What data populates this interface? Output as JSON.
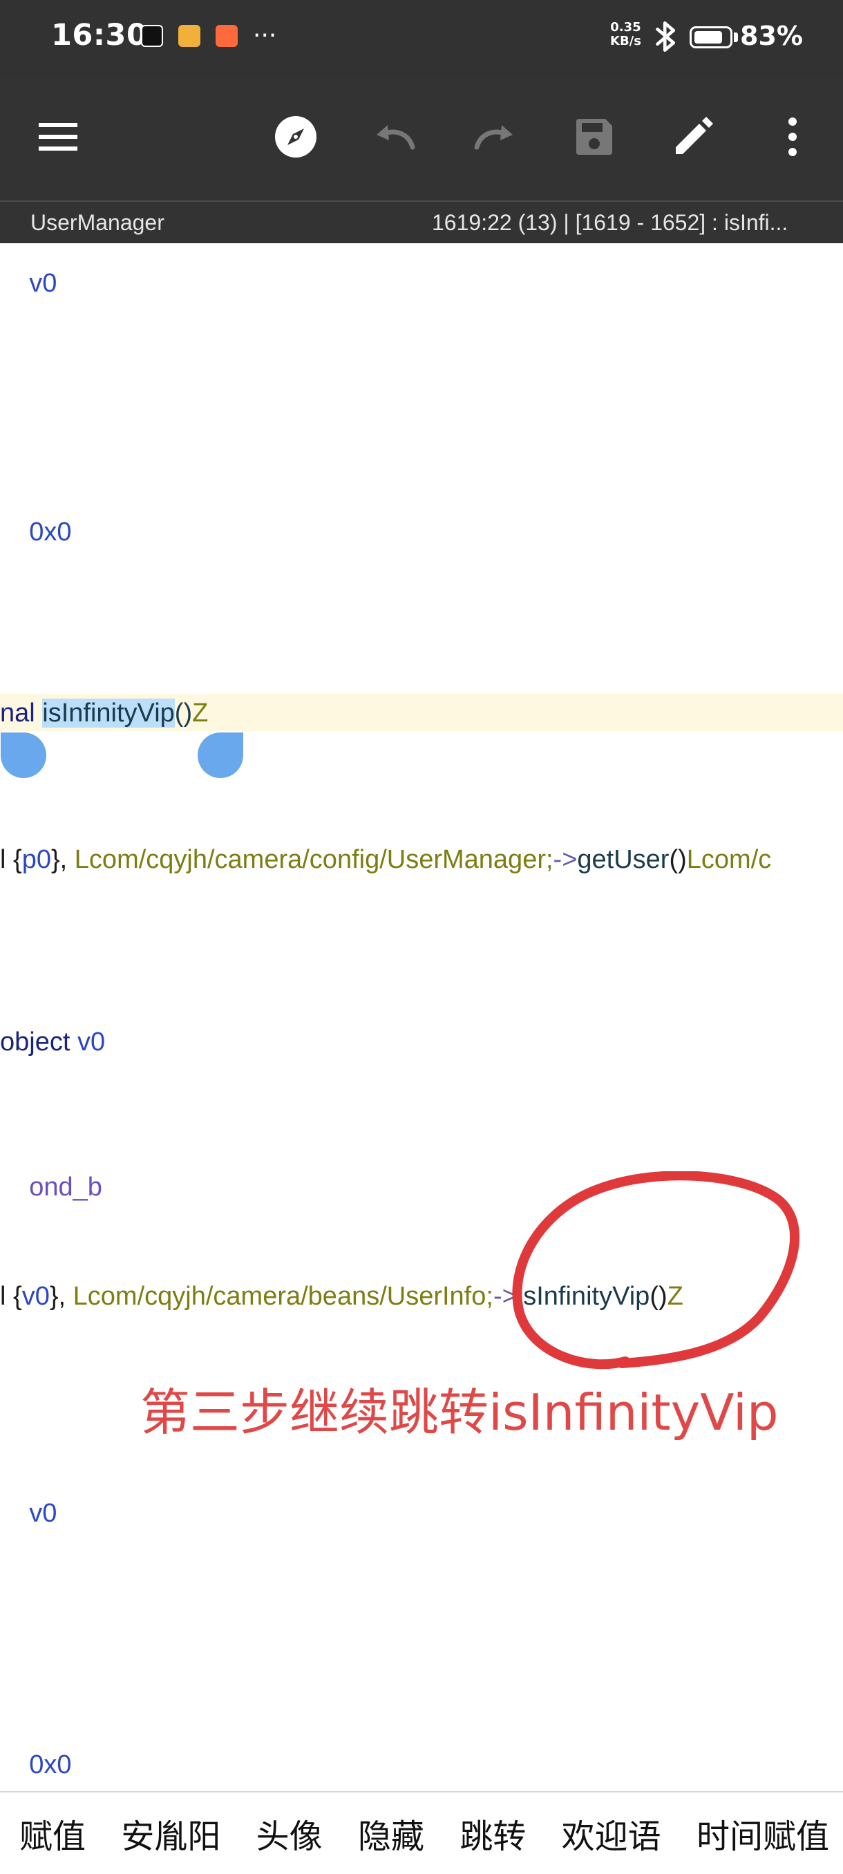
{
  "status_bar": {
    "time": "16:30",
    "network_speed_value": "0.35",
    "network_speed_unit": "KB/s",
    "battery_percent": "83%",
    "battery_level": 0.83,
    "notification_icons": [
      "tiktok-icon",
      "photo-icon",
      "mail-icon"
    ],
    "overflow": "···"
  },
  "toolbar": {
    "icons": [
      "menu-icon",
      "compass-icon",
      "undo-icon",
      "redo-icon",
      "save-icon",
      "edit-icon",
      "more-icon"
    ]
  },
  "sub_bar": {
    "file_name": "UserManager",
    "position": "1619:22 (13)   |   [1619 - 1652] : isInfi..."
  },
  "code": {
    "l1": "v0",
    "l2": "0x0",
    "l3_a": "nal ",
    "l3_sel": "isInfinityVip",
    "l3_paren": "()",
    "l3_type": "Z",
    "l4_a": "l {",
    "l4_reg": "p0",
    "l4_b": "}, ",
    "l4_cls": "Lcom/cqyjh/camera/config/UserManager;",
    "l4_arrow": "->",
    "l4_meth": "getUser",
    "l4_paren": "()",
    "l4_ret": "Lcom/c",
    "l5_a": "object ",
    "l5_reg": "v0",
    "l6": "ond_b",
    "l7_a": "l {",
    "l7_reg": "v0",
    "l7_b": "}, ",
    "l7_cls": "Lcom/cqyjh/camera/beans/UserInfo;",
    "l7_arrow": "->",
    "l7_meth": "isInfinityVip",
    "l7_paren": "()",
    "l7_type": "Z",
    "l8": "v0",
    "l9": "0x0"
  },
  "annotation": {
    "text": "第三步继续跳转isInfinityVip",
    "color": "#e04848"
  },
  "bottom_bar": {
    "items": [
      "赋值",
      "安胤阳",
      "头像",
      "隐藏",
      "跳转",
      "欢迎语",
      "时间赋值"
    ]
  }
}
